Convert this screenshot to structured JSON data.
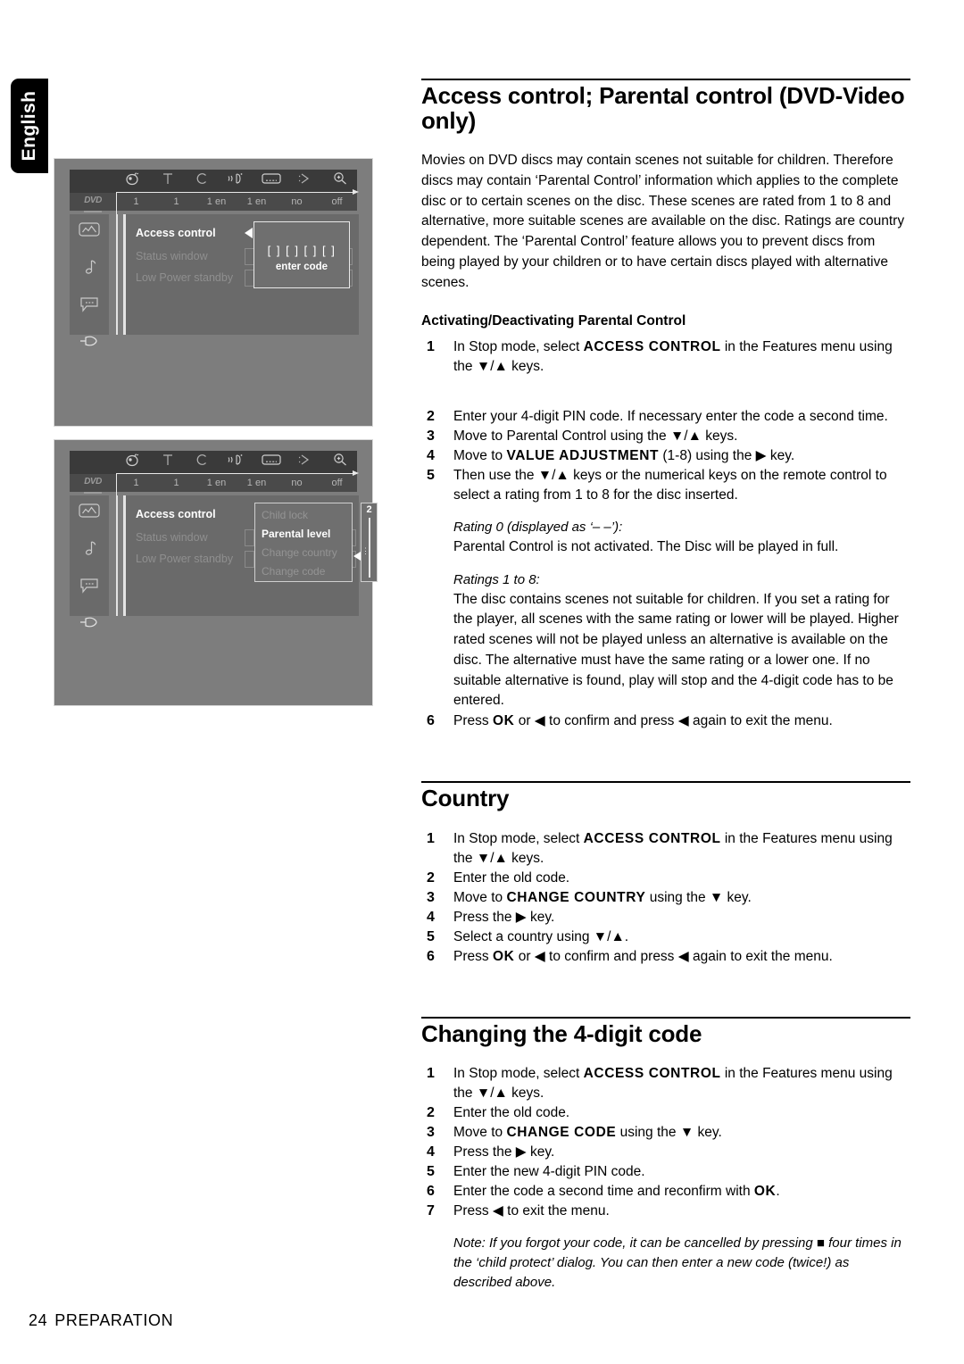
{
  "language_tab": {
    "label": "English"
  },
  "footer": {
    "page_number": "24",
    "section": "PREPARATION"
  },
  "figures": {
    "osd_topbar": {
      "disc_label": "DVD",
      "icons": [
        "angle-icon",
        "title-icon",
        "chapter-icon",
        "audio-icon",
        "subtitle-icon",
        "scan-icon",
        "zoom-icon"
      ],
      "values": [
        "1",
        "1",
        "1 en",
        "1 en",
        "no",
        "off"
      ]
    },
    "sidebar_icons": [
      "picture-icon",
      "audio-note-icon",
      "subtitle-bubble-icon",
      "features-hand-icon"
    ],
    "menu_items": [
      "Access control",
      "Status window",
      "Low Power standby"
    ],
    "figure1": {
      "dialog": {
        "code_boxes": "[ ] [ ] [ ] [ ]",
        "label": "enter code"
      }
    },
    "figure2": {
      "submenu_items": [
        "Child lock",
        "Parental level",
        "Change country",
        "Change code"
      ],
      "selected_item": "Parental level",
      "slider_value": "2"
    }
  },
  "main": {
    "title": "Access control; Parental control (DVD-Video only)",
    "intro": "Movies on DVD discs may contain scenes not suitable for children. Therefore discs may contain ‘Parental Control’ information which applies to the complete disc or to certain scenes on the disc. These scenes are rated from 1 to 8 and alternative, more suitable scenes are available on the disc. Ratings are country dependent. The ‘Parental Control’ feature allows you to prevent discs from being played by your children or to have certain discs played with alternative scenes.",
    "subheading": "Activating/Deactivating Parental Control",
    "steps": [
      {
        "num": "1",
        "text_before": "In Stop mode, select ",
        "bold": "ACCESS CONTROL",
        "text_after": " in the Features menu using the ▼/▲ keys."
      },
      {
        "num": "2",
        "text_before": "Enter your 4-digit PIN code. If necessary enter the code a second time.",
        "bold": "",
        "text_after": ""
      },
      {
        "num": "3",
        "text_before": "Move to Parental Control using the ▼/▲ keys.",
        "bold": "",
        "text_after": ""
      },
      {
        "num": "4",
        "text_before": "Move to ",
        "bold": "VALUE ADJUSTMENT",
        "text_after": " (1-8) using the ▶ key."
      },
      {
        "num": "5",
        "text_before": "Then use the ▼/▲ keys or the numerical keys on the remote control to select a rating from 1 to 8 for the disc inserted.",
        "bold": "",
        "text_after": ""
      }
    ],
    "rating0_heading": "Rating 0 (displayed as ‘– –’):",
    "rating0_text": "Parental Control is not activated. The Disc will be played in full.",
    "ratings18_heading": "Ratings 1 to 8:",
    "ratings18_text": "The disc contains scenes not suitable for children. If you set a rating for the player, all scenes with the same rating or lower will be played. Higher rated scenes will not be played unless an alternative is available on the disc. The alternative must have the same rating or a lower one. If no suitable alternative is found, play will stop and the 4-digit code has to be entered.",
    "step6": {
      "num": "6",
      "text_before": "Press ",
      "bold": "OK",
      "text_after": " or ◀ to confirm and press ◀ again to exit the menu."
    }
  },
  "country": {
    "title": "Country",
    "steps": [
      {
        "num": "1",
        "text_before": "In Stop mode, select ",
        "bold": "ACCESS CONTROL",
        "text_after": " in the Features menu using the ▼/▲ keys."
      },
      {
        "num": "2",
        "text_before": "Enter the old code.",
        "bold": "",
        "text_after": ""
      },
      {
        "num": "3",
        "text_before": "Move to ",
        "bold": "CHANGE COUNTRY",
        "text_after": " using the ▼ key."
      },
      {
        "num": "4",
        "text_before": "Press the ▶ key.",
        "bold": "",
        "text_after": ""
      },
      {
        "num": "5",
        "text_before": "Select a country using ▼/▲.",
        "bold": "",
        "text_after": ""
      },
      {
        "num": "6",
        "text_before": "Press ",
        "bold": "OK",
        "text_after": " or ◀ to confirm and press ◀ again to exit the menu."
      }
    ]
  },
  "changecode": {
    "title": "Changing the 4-digit code",
    "steps": [
      {
        "num": "1",
        "text_before": "In Stop mode, select ",
        "bold": "ACCESS CONTROL",
        "text_after": " in the Features menu using the ▼/▲ keys."
      },
      {
        "num": "2",
        "text_before": "Enter the old code.",
        "bold": "",
        "text_after": ""
      },
      {
        "num": "3",
        "text_before": "Move to ",
        "bold": "CHANGE CODE",
        "text_after": " using the ▼ key."
      },
      {
        "num": "4",
        "text_before": "Press the ▶ key.",
        "bold": "",
        "text_after": ""
      },
      {
        "num": "5",
        "text_before": "Enter the new 4-digit PIN code.",
        "bold": "",
        "text_after": ""
      },
      {
        "num": "6",
        "text_before": "Enter the code a second time and reconfirm with ",
        "bold": "OK",
        "text_after": "."
      },
      {
        "num": "7",
        "text_before": "Press ◀ to exit the menu.",
        "bold": "",
        "text_after": ""
      }
    ],
    "note": "Note: If you forgot your code, it can be cancelled by pressing ■ four times in the ‘child protect’ dialog. You can then enter a new code (twice!) as described above."
  }
}
